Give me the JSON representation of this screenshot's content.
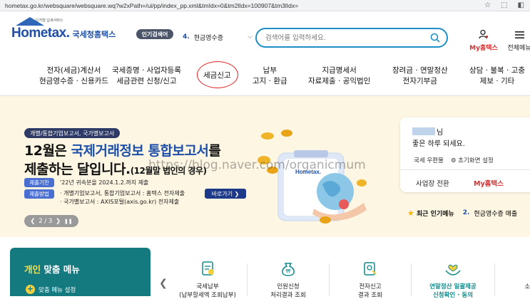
{
  "browser": {
    "url": "hometax.go.kr/websquare/websquare.wq?w2xPath=/ui/pp/index_pp.xml&tmIdx=0&tm2lIdx=100907&tm3lIdx="
  },
  "header": {
    "logo_tagline": "디지털 납세서비스",
    "logo_word": "Hometax.",
    "logo_kr": "국세청홈택스",
    "popular_badge": "인기검색어",
    "popular_num": "4.",
    "popular_term": "현금영수증",
    "search_placeholder": "검색어를 입력하세요.",
    "my_label": "My홈택스",
    "menu_label": "전체메뉴"
  },
  "gnb": {
    "items": [
      {
        "line1": "전자(세금)계산서",
        "line2": "현금영수증 · 신용카드"
      },
      {
        "line1": "국세증명 · 사업자등록",
        "line2": "세금관련 신청/신고"
      },
      {
        "line1": "세금신고",
        "line2": ""
      },
      {
        "line1": "납부",
        "line2": "고지 · 환급"
      },
      {
        "line1": "지급명세서",
        "line2": "자료제출 · 공익법인"
      },
      {
        "line1": "장려금 · 연말정산",
        "line2": "전자기부금"
      },
      {
        "line1": "상담 · 불복 · 고충",
        "line2": "제보 · 기타"
      }
    ]
  },
  "banner": {
    "tag": "개별/통합기업보고서, 국가별보고서",
    "headline1_a": "12월은 ",
    "headline1_b": "국제거래정보 통합보고서",
    "headline1_c": "를",
    "headline2_a": "제출하는 달입니다.",
    "headline2_b": "(12월말 법인의 경우)",
    "chip1": "제출기한",
    "desc1": "'22년 귀속분을 2024.1.2.까지 제출",
    "chip2": "제출방법",
    "desc2a": "· 개별기업보고서, 통합기업보고서 : 홈택스 전자제출",
    "desc2b": "· 국가별보고서 : AXIS포털(axis.go.kr) 전자제출",
    "goto_label": "바로가기 ❯",
    "pager": {
      "prev": "❮",
      "current": "2 / 3",
      "next": "❯",
      "pause": "❚❚"
    },
    "watermark": "https://blog.naver.com/organicmum",
    "illus_logo": "Hometax."
  },
  "login": {
    "name_suffix": "님",
    "greeting": "좋은 하루 되세요.",
    "link1": "국세 우편물",
    "link2": "초기화면 설정",
    "btn1": "사업장 전환",
    "btn2": "My홈택스"
  },
  "popular_bar": {
    "title": "최근 인기메뉴",
    "num": "2.",
    "term": "현금영수증 매출"
  },
  "custom_menu": {
    "title_a": "개인",
    "title_b": " 맞춤 메뉴",
    "setting": "맞춤 메뉴 설정"
  },
  "quick": {
    "prev": "❮",
    "items": [
      {
        "label": "국세납부",
        "sub": "(납부할세액 조회납부)",
        "accent": false
      },
      {
        "label": "민원신청",
        "sub": "처리결과 조회",
        "accent": false
      },
      {
        "label": "전자신고",
        "sub": "결과 조회",
        "accent": false
      },
      {
        "label": "연말정산 일괄제공",
        "sub": "신청확인 · 동의",
        "accent": true
      },
      {
        "label": "소득공제",
        "sub": "",
        "accent": false
      }
    ]
  }
}
